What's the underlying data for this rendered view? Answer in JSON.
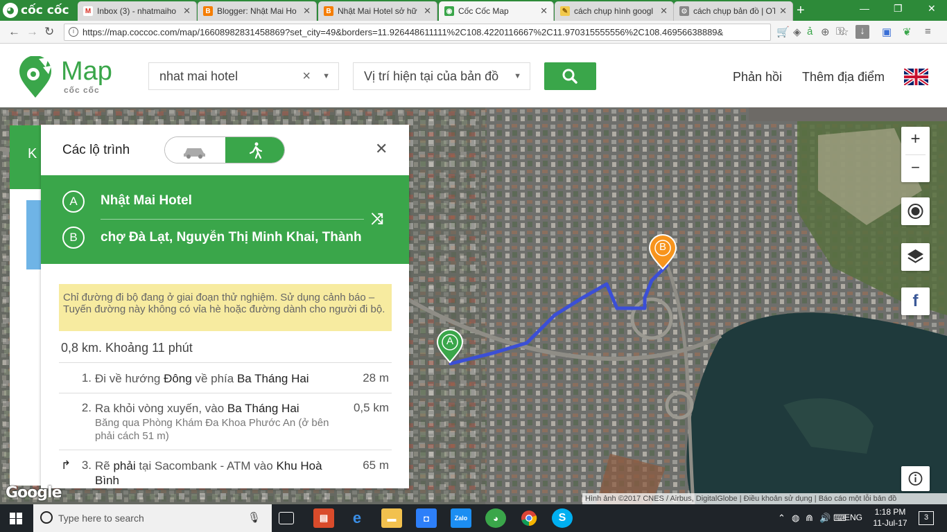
{
  "browser": {
    "brand": "cốc cốc",
    "tabs": [
      {
        "title": "Inbox (3) - nhatmaiho",
        "fav": "M",
        "color": "#ffffff",
        "fcolor": "#d93025"
      },
      {
        "title": "Blogger: Nhật Mai Ho",
        "fav": "B",
        "color": "#f57d00",
        "fcolor": "#ffffff"
      },
      {
        "title": "Nhật Mai Hotel sở hữ",
        "fav": "B",
        "color": "#f57d00",
        "fcolor": "#ffffff"
      },
      {
        "title": "Cốc Cốc Map",
        "fav": "◉",
        "color": "#3aa64a",
        "fcolor": "#ffffff"
      },
      {
        "title": "cách chụp hình googl",
        "fav": "✎",
        "color": "#f2c94c",
        "fcolor": "#8a5a00"
      },
      {
        "title": "cách chụp bản đồ | OT",
        "fav": "⊙",
        "color": "#888888",
        "fcolor": "#ffffff"
      }
    ],
    "url": "https://map.coccoc.com/map/16608982831458869?set_city=49&borders=11.926448611111%2C108.4220116667%2C11.970315555556%2C108.46956638889&"
  },
  "header": {
    "logo_main": "Map",
    "logo_sub": "cốc cốc",
    "search_value": "nhat mai hotel",
    "location_value": "Vị trí hiện tại của bản đồ",
    "feedback": "Phản hồi",
    "add_place": "Thêm địa điểm"
  },
  "back_panel_letter": "K",
  "panel": {
    "title": "Các lộ trình",
    "point_a_letter": "A",
    "point_a": "Nhật Mai Hotel",
    "point_b_letter": "B",
    "point_b": "chợ Đà Lạt, Nguyễn Thị Minh Khai, Thành",
    "warning": "Chỉ đường đi bộ đang ở giai đoạn thử nghiệm. Sử dụng cảnh báo – Tuyến đường này không có vỉa hè hoặc đường dành cho người đi bộ.",
    "summary": "0,8 km. Khoảng 11 phút",
    "steps": [
      {
        "num": "1.",
        "pre": "Đi về hướng ",
        "b1": "Đông",
        "mid": " về phía ",
        "b2": "Ba Tháng Hai",
        "sub": "",
        "dist": "28 m"
      },
      {
        "num": "2.",
        "pre": "Ra khỏi vòng xuyến, vào ",
        "b1": "Ba Tháng Hai",
        "mid": "",
        "b2": "",
        "sub": "Băng qua Phòng Khám Đa Khoa Phước An (ở bên phải cách 51 m)",
        "dist": "0,5 km"
      },
      {
        "num": "3.",
        "pre": "Rẽ ",
        "b1": "phải",
        "mid": " tại Sacombank - ATM vào ",
        "b2": "Khu Hoà Bình",
        "sub": "",
        "dist": "65 m"
      }
    ]
  },
  "map": {
    "marker_a": "A",
    "marker_b": "B",
    "zoom_in": "+",
    "zoom_out": "−",
    "google": "Google",
    "attribution": "Hình ảnh ©2017 CNES / Airbus, DigitalGlobe  |  Điều khoản sử dụng  |  Báo cáo một lỗi bản đồ"
  },
  "taskbar": {
    "search_placeholder": "Type here to search",
    "lang": "ENG",
    "time": "1:18 PM",
    "date": "11-Jul-17",
    "notif_count": "3"
  },
  "colors": {
    "accent": "#3aa64a",
    "route": "#3b4fd6",
    "marker_b": "#f7941d"
  }
}
